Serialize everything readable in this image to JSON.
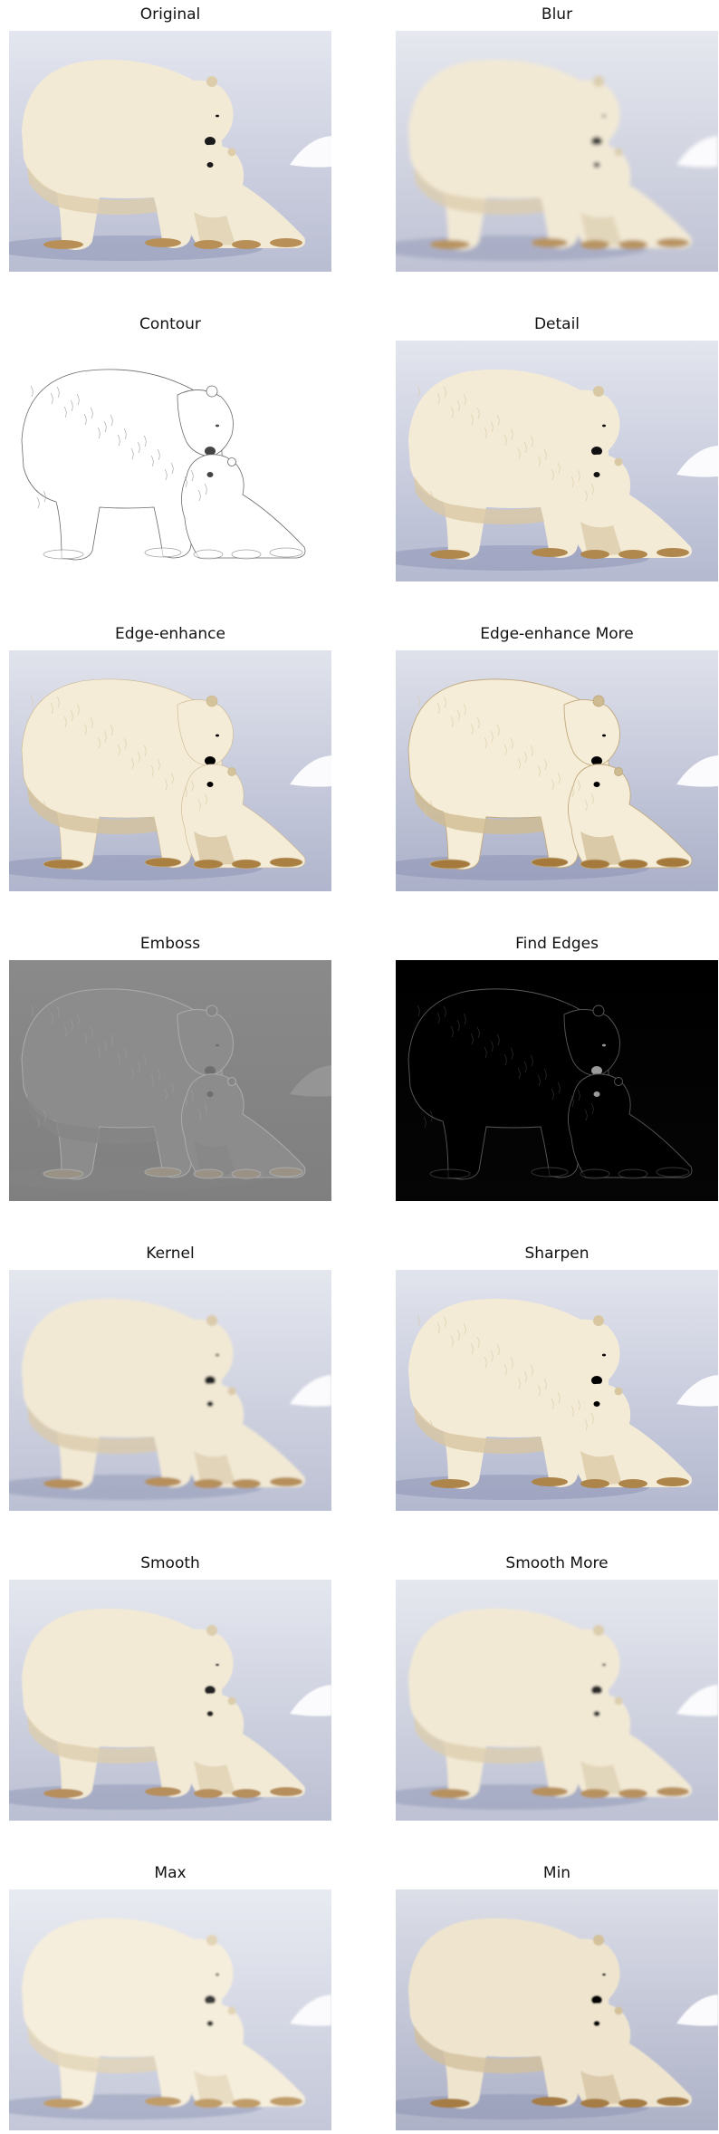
{
  "panels": [
    {
      "title": "Original",
      "filter": "original"
    },
    {
      "title": "Blur",
      "filter": "blur"
    },
    {
      "title": "Contour",
      "filter": "contour"
    },
    {
      "title": "Detail",
      "filter": "detail"
    },
    {
      "title": "Edge-enhance",
      "filter": "edge-enhance"
    },
    {
      "title": "Edge-enhance More",
      "filter": "edge-enhance-more"
    },
    {
      "title": "Emboss",
      "filter": "emboss"
    },
    {
      "title": "Find Edges",
      "filter": "find-edges"
    },
    {
      "title": "Kernel",
      "filter": "kernel"
    },
    {
      "title": "Sharpen",
      "filter": "sharpen"
    },
    {
      "title": "Smooth",
      "filter": "smooth"
    },
    {
      "title": "Smooth More",
      "filter": "smooth-more"
    },
    {
      "title": "Max",
      "filter": "max"
    },
    {
      "title": "Min",
      "filter": "min"
    }
  ]
}
